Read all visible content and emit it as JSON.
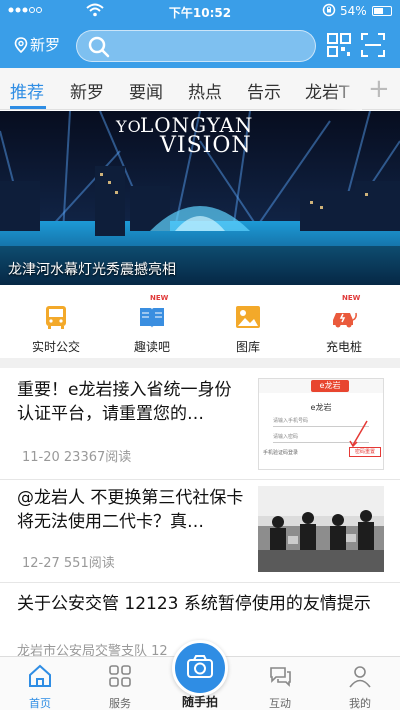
{
  "status_bar": {
    "time": "下午10:52",
    "battery": "54%"
  },
  "header": {
    "location": "新罗"
  },
  "tabs": [
    {
      "label": "推荐"
    },
    {
      "label": "新罗"
    },
    {
      "label": "要闻"
    },
    {
      "label": "热点"
    },
    {
      "label": "告示"
    },
    {
      "label": "龙岩T"
    }
  ],
  "tabs_add": "+",
  "banner": {
    "caption": "龙津河水幕灯光秀震撼亮相",
    "title_line1": "LONGYAN",
    "title_line2": "VISION",
    "title_prefix": "YO"
  },
  "quick_links": [
    {
      "label": "实时公交",
      "icon": "bus-icon",
      "badge": ""
    },
    {
      "label": "趣读吧",
      "icon": "book-icon",
      "badge": "NEW"
    },
    {
      "label": "图库",
      "icon": "image-icon",
      "badge": ""
    },
    {
      "label": "充电桩",
      "icon": "ev-charging-icon",
      "badge": "NEW"
    }
  ],
  "news": [
    {
      "title": "重要！e龙岩接入省统一身份认证平台，请重置您的…",
      "meta": "11-20 23367阅读",
      "thumb_text": {
        "logo": "e龙岩",
        "app": "e龙岩",
        "field1": "请输入手机号码",
        "field2": "请输入密码",
        "row": "手机验证码登录",
        "link": "密码重置"
      }
    },
    {
      "title": "@龙岩人 不更换第三代社保卡将无法使用二代卡？真…",
      "meta": "12-27 551阅读"
    },
    {
      "title": "关于公安交管 12123 系统暂停使用的友情提示",
      "meta": "龙岩市公安局交警支队 12"
    }
  ],
  "tabbar": [
    {
      "label": "首页",
      "icon": "home-icon"
    },
    {
      "label": "服务",
      "icon": "grid-icon"
    },
    {
      "label": "随手拍",
      "icon": "camera-icon"
    },
    {
      "label": "互动",
      "icon": "chat-icon"
    },
    {
      "label": "我的",
      "icon": "user-icon"
    }
  ],
  "colors": {
    "primary": "#3a9ee8",
    "accent": "#2f8de4",
    "badge": "#e03a3a"
  }
}
